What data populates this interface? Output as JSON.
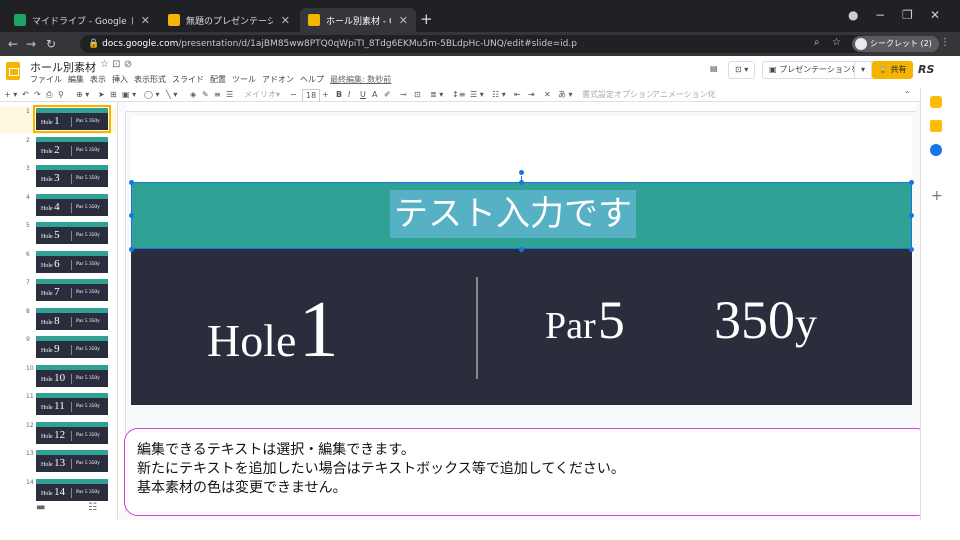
{
  "browser": {
    "tabs": [
      {
        "title": "マイドライブ - Google ドライブ",
        "color": "#f4b400"
      },
      {
        "title": "無題のプレゼンテーション - Google ス",
        "color": "#f4b400"
      },
      {
        "title": "ホール別素材 - Google スライド",
        "color": "#f4b400"
      }
    ],
    "url_host": "docs.google.com",
    "url_path": "/presentation/d/1ajBM85ww8PTQ0qWpiTI_8Tdg6EKMu5m-5BLdpHc-UNQ/edit#slide=id.p",
    "profile_label": "シークレット (2)"
  },
  "app": {
    "doc_title": "ホール別素材",
    "doc_icons": "☆ ⊡ ⊘",
    "menus": [
      "ファイル",
      "編集",
      "表示",
      "挿入",
      "表示形式",
      "スライド",
      "配置",
      "ツール",
      "アドオン",
      "ヘルプ",
      "最終編集: 数秒前"
    ],
    "present_label": "プレゼンテーションを開始",
    "share_label": "共有",
    "user_initials": "RS"
  },
  "toolbar": {
    "font_name": "メイリオ",
    "font_size": "18",
    "format_options": "書式設定オプション",
    "animation": "アニメーション化"
  },
  "filmstrip": {
    "thumbs": [
      {
        "num": "1",
        "hole": "1"
      },
      {
        "num": "2",
        "hole": "2"
      },
      {
        "num": "3",
        "hole": "3"
      },
      {
        "num": "4",
        "hole": "4"
      },
      {
        "num": "5",
        "hole": "5"
      },
      {
        "num": "6",
        "hole": "6"
      },
      {
        "num": "7",
        "hole": "7"
      },
      {
        "num": "8",
        "hole": "8"
      },
      {
        "num": "9",
        "hole": "9"
      },
      {
        "num": "10",
        "hole": "10"
      },
      {
        "num": "11",
        "hole": "11"
      },
      {
        "num": "12",
        "hole": "12"
      },
      {
        "num": "13",
        "hole": "13"
      },
      {
        "num": "14",
        "hole": "14"
      }
    ],
    "thumb_word": "Hole",
    "thumb_par": "Par 5  350y"
  },
  "slide": {
    "title_text": "テスト入力です",
    "hole_word": "Hole",
    "hole_num": "1",
    "par_word": "Par",
    "par_num": "5",
    "yard_num": "350",
    "yard_unit": "y",
    "colors": {
      "teal": "#2fa295",
      "dark": "#2a2d3c"
    }
  },
  "note": {
    "line1": "編集できるテキストは選択・編集できます。",
    "line2": "新たにテキストを追加したい場合はテキストボックス等で追加してください。",
    "line3": "基本素材の色は変更できません。"
  }
}
